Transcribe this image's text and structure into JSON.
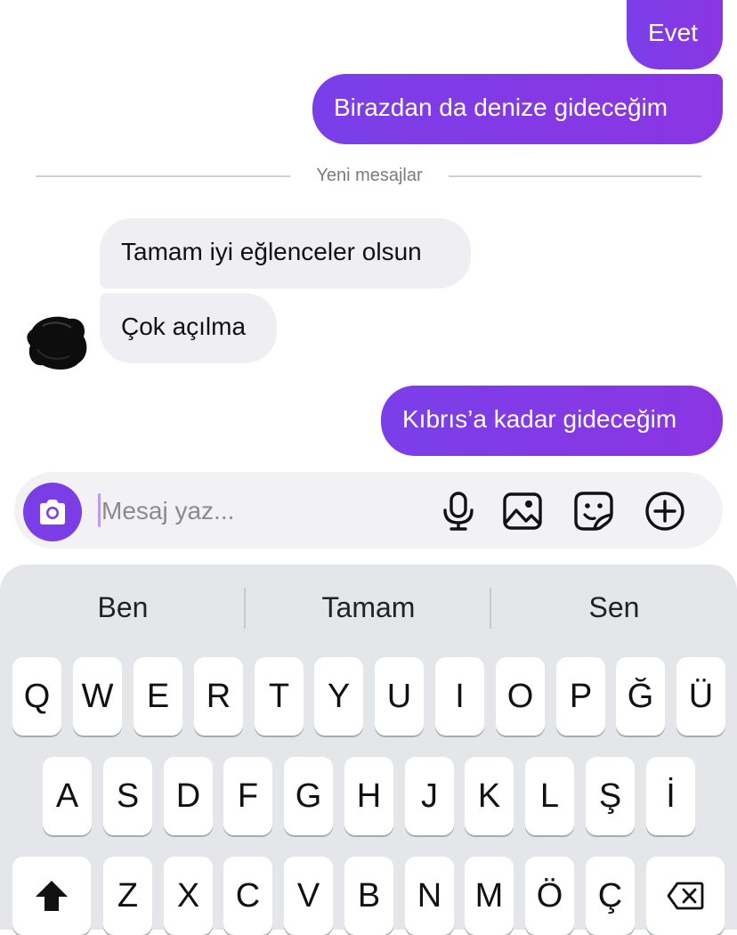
{
  "conversation": {
    "messages": [
      {
        "text": "Evet",
        "direction": "outgoing"
      },
      {
        "text": "Birazdan da denize gideceğim",
        "direction": "outgoing"
      },
      {
        "text": "Tamam iyi eğlenceler olsun",
        "direction": "incoming"
      },
      {
        "text": "Çok açılma",
        "direction": "incoming"
      },
      {
        "text": "Kıbrıs’a kadar gideceğim",
        "direction": "outgoing"
      }
    ],
    "new_messages_divider": "Yeni mesajlar"
  },
  "composer": {
    "placeholder": "Mesaj yaz...",
    "icons": [
      "camera-icon",
      "microphone-icon",
      "gallery-icon",
      "sticker-icon",
      "plus-icon"
    ]
  },
  "keyboard": {
    "suggestions": [
      "Ben",
      "Tamam",
      "Sen"
    ],
    "rows": [
      [
        "Q",
        "W",
        "E",
        "R",
        "T",
        "Y",
        "U",
        "I",
        "O",
        "P",
        "Ğ",
        "Ü"
      ],
      [
        "A",
        "S",
        "D",
        "F",
        "G",
        "H",
        "J",
        "K",
        "L",
        "Ş",
        "İ"
      ],
      [
        "Z",
        "X",
        "C",
        "V",
        "B",
        "N",
        "M",
        "Ö",
        "Ç"
      ]
    ],
    "special_keys": [
      "shift-icon",
      "backspace-icon"
    ]
  },
  "colors": {
    "accent": "#7b3ee6",
    "incoming_bubble": "#efeff3",
    "keyboard_bg": "#e5e6ea"
  }
}
